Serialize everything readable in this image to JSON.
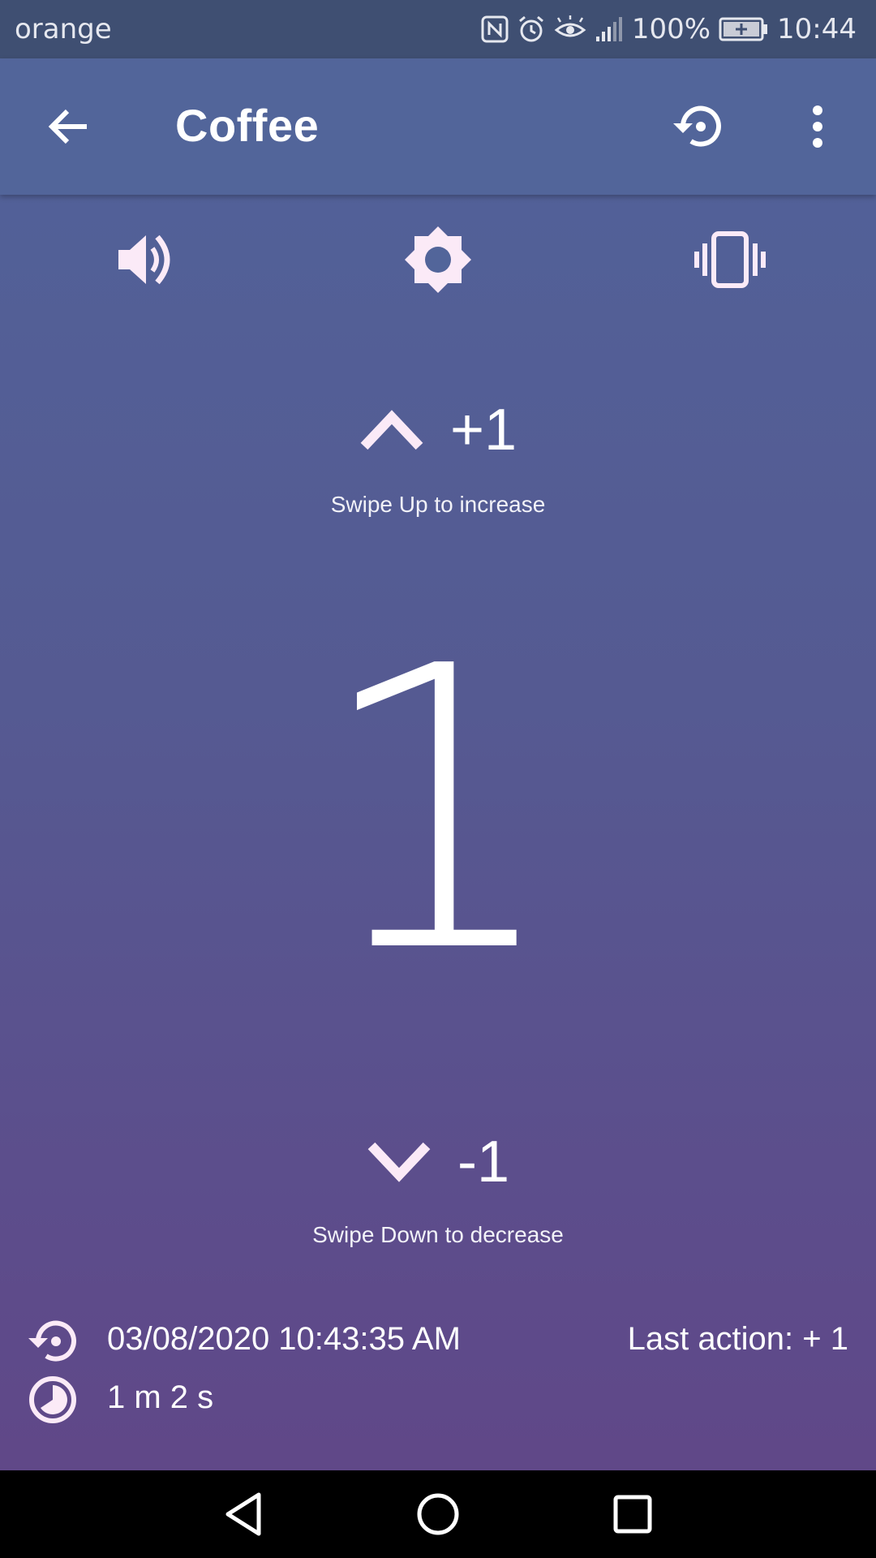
{
  "status_bar": {
    "carrier": "orange",
    "battery": "100%",
    "time": "10:44",
    "icons": [
      "nfc-icon",
      "alarm-icon",
      "eye-comfort-icon",
      "signal-icon",
      "battery-charging-icon"
    ]
  },
  "app_bar": {
    "title": "Coffee",
    "back_icon": "arrow-back-icon",
    "reset_icon": "reset-history-icon",
    "menu_icon": "more-vert-icon"
  },
  "toggles": [
    {
      "name": "sound",
      "icon": "volume-icon"
    },
    {
      "name": "brightness",
      "icon": "brightness-icon"
    },
    {
      "name": "vibration",
      "icon": "vibrate-icon"
    }
  ],
  "increase": {
    "value": "+1",
    "hint": "Swipe Up to increase"
  },
  "counter": {
    "value": "1"
  },
  "decrease": {
    "value": "-1",
    "hint": "Swipe Down to decrease"
  },
  "footer": {
    "last_reset": "03/08/2020 10:43:35 AM",
    "last_action": "Last action: + 1",
    "elapsed": "1 m 2 s"
  },
  "colors": {
    "status_bar": "#3f4f72",
    "app_bar": "#52659a",
    "gradient_top": "#51639a",
    "gradient_bottom": "#614687",
    "icon_tint": "#fbeaf7"
  }
}
